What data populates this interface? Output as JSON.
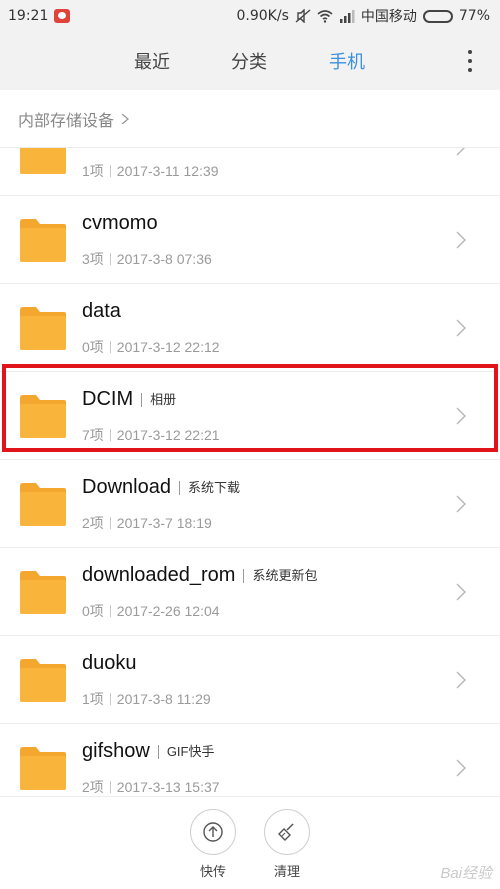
{
  "status_bar": {
    "time": "19:21",
    "speed": "0.90K/s",
    "carrier": "中国移动",
    "battery": "77%",
    "battery_level": 0.77
  },
  "tabs": [
    {
      "label": "最近",
      "active": false
    },
    {
      "label": "分类",
      "active": false
    },
    {
      "label": "手机",
      "active": true
    }
  ],
  "breadcrumb": {
    "label": "内部存储设备"
  },
  "files": [
    {
      "name": "",
      "tag": "",
      "count": "1项",
      "date": "2017-3-11 12:39"
    },
    {
      "name": "cvmomo",
      "tag": "",
      "count": "3项",
      "date": "2017-3-8 07:36"
    },
    {
      "name": "data",
      "tag": "",
      "count": "0项",
      "date": "2017-3-12 22:12"
    },
    {
      "name": "DCIM",
      "tag": "相册",
      "count": "7项",
      "date": "2017-3-12 22:21"
    },
    {
      "name": "Download",
      "tag": "系统下载",
      "count": "2项",
      "date": "2017-3-7 18:19"
    },
    {
      "name": "downloaded_rom",
      "tag": "系统更新包",
      "count": "0项",
      "date": "2017-2-26 12:04"
    },
    {
      "name": "duoku",
      "tag": "",
      "count": "1项",
      "date": "2017-3-8 11:29"
    },
    {
      "name": "gifshow",
      "tag": "GIF快手",
      "count": "2项",
      "date": "2017-3-13 15:37"
    }
  ],
  "bottom_bar": {
    "share_label": "快传",
    "clean_label": "清理"
  },
  "watermark": "Bai经验",
  "colors": {
    "accent": "#3b8fde",
    "folder": "#f9b53b",
    "highlight": "#e2141b"
  }
}
